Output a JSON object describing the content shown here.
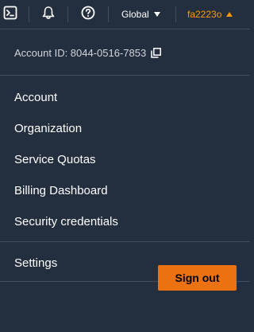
{
  "topbar": {
    "icons": [
      "cloudshell-icon",
      "bell-icon",
      "help-icon"
    ],
    "region_label": "Global",
    "user_label": "fa2223o"
  },
  "account": {
    "id_text": "Account ID: 8044-0516-7853"
  },
  "menu": {
    "items": [
      {
        "label": "Account"
      },
      {
        "label": "Organization"
      },
      {
        "label": "Service Quotas"
      },
      {
        "label": "Billing Dashboard"
      },
      {
        "label": "Security credentials"
      }
    ],
    "settings_label": "Settings"
  },
  "actions": {
    "signout_label": "Sign out"
  },
  "colors": {
    "background": "#232f3e",
    "accent": "#ff9900",
    "button": "#ec7211",
    "divider": "#414d5c"
  }
}
